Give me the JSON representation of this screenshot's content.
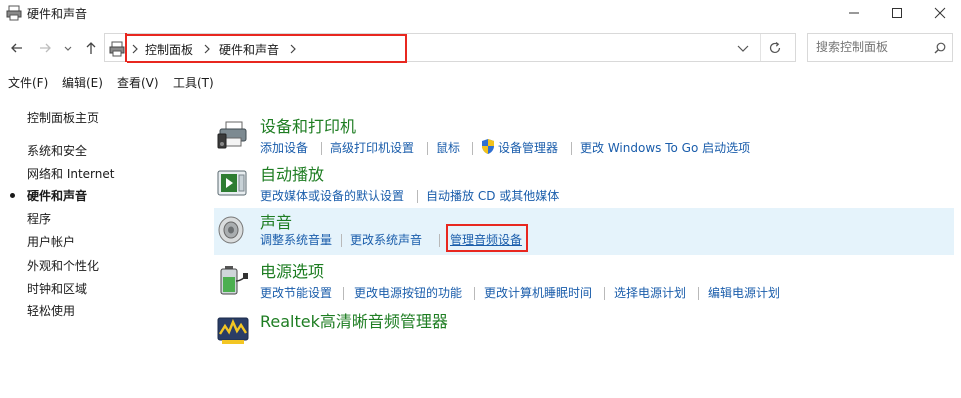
{
  "window": {
    "title": "硬件和声音",
    "minimize_label": "—",
    "maximize_label": "☐",
    "close_label": "✕"
  },
  "address": {
    "breadcrumbs": [
      "控制面板",
      "硬件和声音"
    ],
    "search_placeholder": "搜索控制面板"
  },
  "menu": [
    "文件(F)",
    "编辑(E)",
    "查看(V)",
    "工具(T)"
  ],
  "sidebar": {
    "home": "控制面板主页",
    "items": [
      "系统和安全",
      "网络和 Internet",
      "硬件和声音",
      "程序",
      "用户帐户",
      "外观和个性化",
      "时钟和区域",
      "轻松使用"
    ],
    "active_index": 2
  },
  "categories": [
    {
      "title": "设备和打印机",
      "icon": "printer-icon",
      "links": [
        "添加设备",
        "高级打印机设置",
        "鼠标",
        "设备管理器",
        "更改 Windows To Go 启动选项"
      ]
    },
    {
      "title": "自动播放",
      "icon": "autoplay-icon",
      "links": [
        "更改媒体或设备的默认设置",
        "自动播放 CD 或其他媒体"
      ]
    },
    {
      "title": "声音",
      "icon": "speaker-icon",
      "links": [
        "调整系统音量",
        "更改系统声音",
        "管理音频设备"
      ],
      "highlighted": true
    },
    {
      "title": "电源选项",
      "icon": "battery-icon",
      "links": [
        "更改节能设置",
        "更改电源按钮的功能",
        "更改计算机睡眠时间",
        "选择电源计划",
        "编辑电源计划"
      ]
    },
    {
      "title": "Realtek高清晰音频管理器",
      "icon": "realtek-audio-icon",
      "links": []
    }
  ],
  "colors": {
    "category_title": "#1e7d22",
    "link": "#1a5dab",
    "highlight_bg": "#e5f3fb",
    "annotation_red": "#e8271f"
  }
}
